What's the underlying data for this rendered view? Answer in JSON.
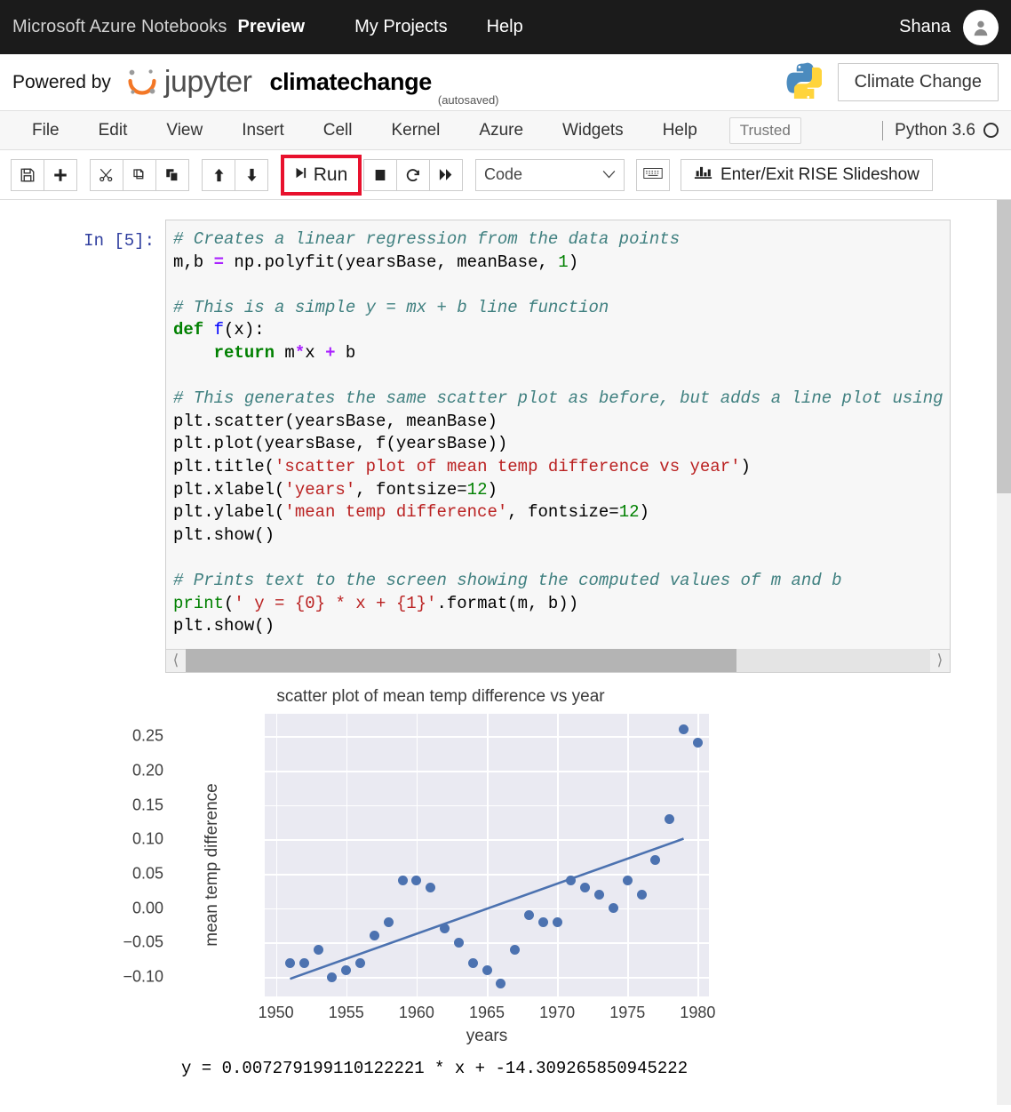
{
  "azure_bar": {
    "brand": "Microsoft Azure Notebooks",
    "preview": "Preview",
    "links": [
      {
        "label": "My Projects",
        "name": "my-projects"
      },
      {
        "label": "Help",
        "name": "help"
      }
    ],
    "user": "Shana",
    "avatar_icon": "user-avatar-icon"
  },
  "jupyter_header": {
    "powered_by": "Powered by",
    "logo_text": "jupyter",
    "notebook_name": "climatechange",
    "autosaved": "(autosaved)",
    "python_logo_icon": "python-logo-icon",
    "project_button": "Climate Change"
  },
  "menubar": {
    "items": [
      "File",
      "Edit",
      "View",
      "Insert",
      "Cell",
      "Kernel",
      "Azure",
      "Widgets",
      "Help"
    ],
    "trusted": "Trusted",
    "kernel_name": "Python 3.6",
    "kernel_status_icon": "kernel-idle-circle-icon"
  },
  "toolbar": {
    "save_icon": "save-floppy-icon",
    "add_icon": "plus-icon",
    "cut_icon": "scissors-icon",
    "copy_icon": "copy-icon",
    "paste_icon": "paste-icon",
    "move_up_icon": "arrow-up-icon",
    "move_down_icon": "arrow-down-icon",
    "run_label": "Run",
    "run_icon": "run-play-icon",
    "stop_icon": "stop-square-icon",
    "restart_icon": "restart-circular-arrow-icon",
    "restart_run_all_icon": "fast-forward-icon",
    "cell_type_value": "Code",
    "cell_type_caret_icon": "chevron-down-icon",
    "command_palette_icon": "keyboard-icon",
    "rise_icon": "bar-chart-icon",
    "rise_label": "Enter/Exit RISE Slideshow"
  },
  "cell": {
    "prompt": "In [5]:",
    "code_lines": [
      {
        "segments": [
          {
            "t": "# Creates a linear regression from the data points",
            "c": "cmt"
          }
        ]
      },
      {
        "segments": [
          {
            "t": "m,b ",
            "c": ""
          },
          {
            "t": "=",
            "c": "op"
          },
          {
            "t": " np.polyfit(yearsBase, meanBase, ",
            "c": ""
          },
          {
            "t": "1",
            "c": "num"
          },
          {
            "t": ")",
            "c": ""
          }
        ]
      },
      {
        "segments": [
          {
            "t": "",
            "c": ""
          }
        ]
      },
      {
        "segments": [
          {
            "t": "# This is a simple y = mx + b line function",
            "c": "cmt"
          }
        ]
      },
      {
        "segments": [
          {
            "t": "def ",
            "c": "kw"
          },
          {
            "t": "f",
            "c": "fn"
          },
          {
            "t": "(x):",
            "c": ""
          }
        ]
      },
      {
        "segments": [
          {
            "t": "    return",
            "c": "kw"
          },
          {
            "t": " m",
            "c": ""
          },
          {
            "t": "*",
            "c": "op"
          },
          {
            "t": "x ",
            "c": ""
          },
          {
            "t": "+",
            "c": "op"
          },
          {
            "t": " b",
            "c": ""
          }
        ]
      },
      {
        "segments": [
          {
            "t": "",
            "c": ""
          }
        ]
      },
      {
        "segments": [
          {
            "t": "# This generates the same scatter plot as before, but adds a line plot using",
            "c": "cmt"
          }
        ]
      },
      {
        "segments": [
          {
            "t": "plt.scatter(yearsBase, meanBase)",
            "c": ""
          }
        ]
      },
      {
        "segments": [
          {
            "t": "plt.plot(yearsBase, f(yearsBase))",
            "c": ""
          }
        ]
      },
      {
        "segments": [
          {
            "t": "plt.title(",
            "c": ""
          },
          {
            "t": "'scatter plot of mean temp difference vs year'",
            "c": "str"
          },
          {
            "t": ")",
            "c": ""
          }
        ]
      },
      {
        "segments": [
          {
            "t": "plt.xlabel(",
            "c": ""
          },
          {
            "t": "'years'",
            "c": "str"
          },
          {
            "t": ", fontsize=",
            "c": ""
          },
          {
            "t": "12",
            "c": "num"
          },
          {
            "t": ")",
            "c": ""
          }
        ]
      },
      {
        "segments": [
          {
            "t": "plt.ylabel(",
            "c": ""
          },
          {
            "t": "'mean temp difference'",
            "c": "str"
          },
          {
            "t": ", fontsize=",
            "c": ""
          },
          {
            "t": "12",
            "c": "num"
          },
          {
            "t": ")",
            "c": ""
          }
        ]
      },
      {
        "segments": [
          {
            "t": "plt.show()",
            "c": ""
          }
        ]
      },
      {
        "segments": [
          {
            "t": "",
            "c": ""
          }
        ]
      },
      {
        "segments": [
          {
            "t": "# Prints text to the screen showing the computed values of m and b",
            "c": "cmt"
          }
        ]
      },
      {
        "segments": [
          {
            "t": "print",
            "c": "bi"
          },
          {
            "t": "(",
            "c": ""
          },
          {
            "t": "' y = {0} * x + {1}'",
            "c": "str"
          },
          {
            "t": ".format(m, b))",
            "c": ""
          }
        ]
      },
      {
        "segments": [
          {
            "t": "plt.show()",
            "c": ""
          }
        ]
      }
    ],
    "hscroll_left_icon": "chevron-left-icon",
    "hscroll_right_icon": "chevron-right-icon"
  },
  "output": {
    "print_text": "y = 0.007279199110122221 * x + -14.309265850945222"
  },
  "chart_data": {
    "type": "scatter",
    "title": "scatter plot of mean temp difference vs year",
    "xlabel": "years",
    "ylabel": "mean temp difference",
    "xlim": [
      1949.2,
      1980.8
    ],
    "ylim": [
      -0.128,
      0.283
    ],
    "xticks": [
      1950,
      1955,
      1960,
      1965,
      1970,
      1975,
      1980
    ],
    "yticks": [
      -0.1,
      -0.05,
      0.0,
      0.05,
      0.1,
      0.15,
      0.2,
      0.25
    ],
    "ytick_labels": [
      "−0.10",
      "−0.05",
      "0.00",
      "0.05",
      "0.10",
      "0.15",
      "0.20",
      "0.25"
    ],
    "grid": true,
    "legend": "none",
    "point_color": "#4c72b0",
    "line_color": "#4c72b0",
    "plot_bg": "#eaeaf2",
    "x": [
      1951,
      1952,
      1953,
      1954,
      1955,
      1956,
      1957,
      1958,
      1959,
      1960,
      1961,
      1962,
      1963,
      1964,
      1965,
      1966,
      1967,
      1968,
      1969,
      1970,
      1971,
      1972,
      1973,
      1974,
      1975,
      1976,
      1977,
      1978,
      1979,
      1980
    ],
    "y": [
      -0.08,
      -0.08,
      -0.06,
      -0.1,
      -0.09,
      -0.08,
      -0.04,
      -0.02,
      0.04,
      0.04,
      0.03,
      -0.03,
      -0.05,
      -0.08,
      -0.09,
      -0.11,
      -0.06,
      -0.01,
      -0.02,
      -0.02,
      0.04,
      0.03,
      0.02,
      0.0,
      0.04,
      0.02,
      0.07,
      0.13,
      0.26,
      0.24
    ],
    "trendline": {
      "slope": 0.007279199110122221,
      "intercept": -14.309265850945222,
      "x_start": 1951,
      "x_end": 1979,
      "y_start": -0.1024,
      "y_end": 0.1014
    }
  }
}
